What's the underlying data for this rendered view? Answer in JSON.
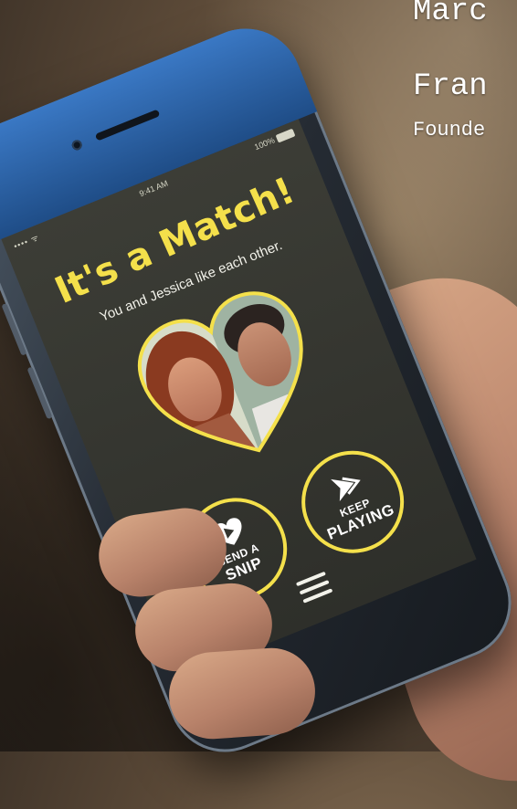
{
  "overlay": {
    "line1": "Marc",
    "line2": "Fran",
    "line3": "Founde"
  },
  "status_bar": {
    "signal": "•••• ᯤ",
    "time": "9:41 AM",
    "battery": "100%"
  },
  "match_screen": {
    "title": "It's a Match!",
    "subtitle": "You and Jessica like each other.",
    "send_button": {
      "line1": "SEND A",
      "line2": "SNIP"
    },
    "keep_button": {
      "line1": "KEEP",
      "line2": "PLAYING"
    }
  },
  "colors": {
    "accent": "#f4e04b",
    "screen_bg": "#34352f",
    "text_light": "#f2f2ea"
  },
  "icons": {
    "send": "heart-play-icon",
    "keep": "fast-forward-arrow-icon",
    "menu": "hamburger-menu-icon"
  }
}
